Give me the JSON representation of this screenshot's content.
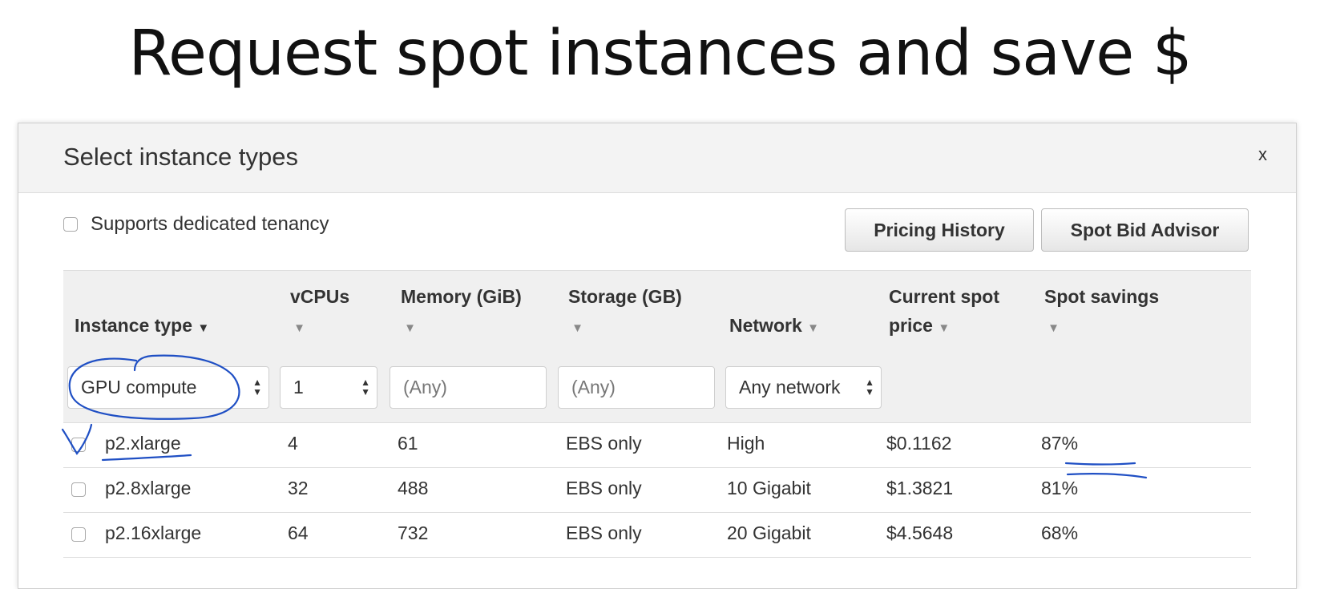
{
  "slide": {
    "title": "Request spot instances and save $"
  },
  "modal": {
    "title": "Select instance types",
    "close_label": "x",
    "tenancy_label": "Supports dedicated tenancy",
    "buttons": {
      "pricing_history": "Pricing History",
      "spot_bid_advisor": "Spot Bid Advisor"
    }
  },
  "table": {
    "columns": {
      "instance_type": "Instance type",
      "vcpus": "vCPUs",
      "memory": "Memory (GiB)",
      "storage": "Storage (GB)",
      "network": "Network",
      "price_line1": "Current spot",
      "price_line2": "price",
      "savings": "Spot savings"
    },
    "filters": {
      "instance_family": "GPU compute",
      "vcpus": "1",
      "memory_placeholder": "(Any)",
      "storage_placeholder": "(Any)",
      "network": "Any network"
    },
    "rows": [
      {
        "type": "p2.xlarge",
        "vcpus": "4",
        "memory": "61",
        "storage": "EBS only",
        "network": "High",
        "price": "$0.1162",
        "savings": "87%"
      },
      {
        "type": "p2.8xlarge",
        "vcpus": "32",
        "memory": "488",
        "storage": "EBS only",
        "network": "10 Gigabit",
        "price": "$1.3821",
        "savings": "81%"
      },
      {
        "type": "p2.16xlarge",
        "vcpus": "64",
        "memory": "732",
        "storage": "EBS only",
        "network": "20 Gigabit",
        "price": "$4.5648",
        "savings": "68%"
      }
    ]
  },
  "colors": {
    "annotation_ink": "#1f4fc4",
    "header_bg": "#f0f0f0"
  },
  "icons": [
    "close-icon",
    "sort-caret-icon",
    "spinner-arrows-icon",
    "checkbox"
  ]
}
